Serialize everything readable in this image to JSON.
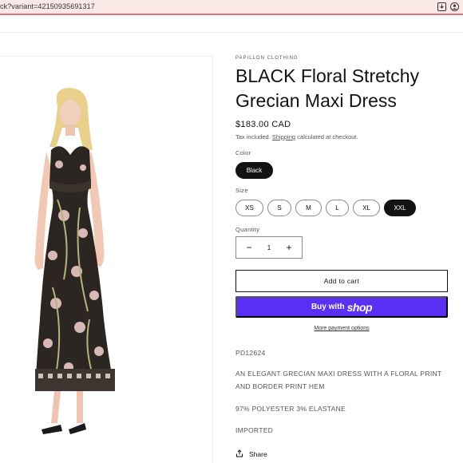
{
  "browser": {
    "url": "ck?variant=42150935691317",
    "icons": [
      "install-app-icon",
      "profile-icon"
    ]
  },
  "product": {
    "vendor": "PAPILLON CLOTHING",
    "title": "BLACK Floral Stretchy Grecian Maxi Dress",
    "price": "$183.00 CAD",
    "tax_prefix": "Tax included.",
    "tax_link": "Shipping",
    "tax_suffix": "calculated at checkout.",
    "image_alt": "Woman wearing black floral Grecian maxi dress"
  },
  "options": {
    "color_label": "Color",
    "colors": [
      "Black"
    ],
    "selected_color": "Black",
    "size_label": "Size",
    "sizes": [
      "XS",
      "S",
      "M",
      "L",
      "XL",
      "XXL"
    ],
    "selected_size": "XXL"
  },
  "quantity": {
    "label": "Quantity",
    "minus": "−",
    "value": "1",
    "plus": "+"
  },
  "buttons": {
    "add_to_cart": "Add to cart",
    "buy_with": "Buy with",
    "shop": "shop",
    "more_payment": "More payment options"
  },
  "description": {
    "sku": "PD12624",
    "summary": "AN ELEGANT GRECIAN MAXI DRESS WITH A FLORAL PRINT AND BORDER PRINT HEM",
    "fabric": "97% POLYESTER 3% ELASTANE",
    "origin": "IMPORTED"
  },
  "share": {
    "label": "Share"
  },
  "colors": {
    "accent": "#5a31f4",
    "selected_pill": "#121212",
    "browser_bar": "#fbe9e7"
  }
}
